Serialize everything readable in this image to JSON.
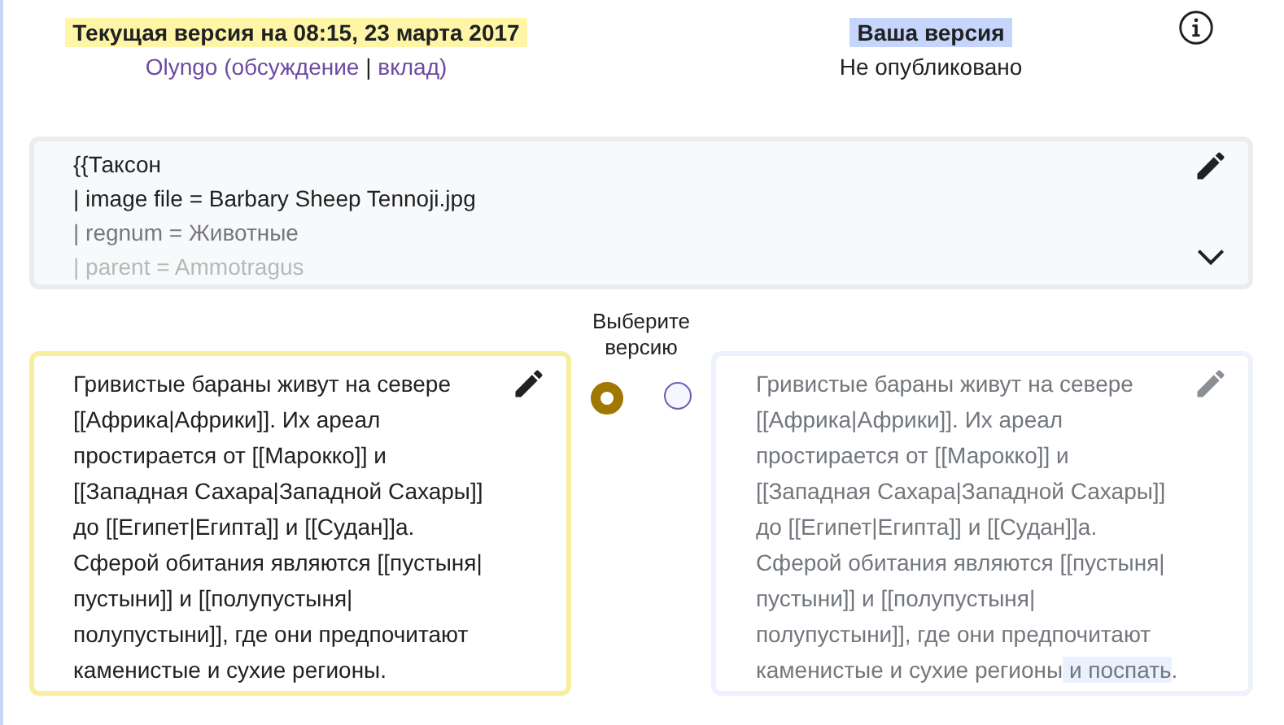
{
  "versions": [
    {
      "label": "Текущая версия на 08:15, 23 марта 2017",
      "color": "#fef6a6",
      "byline": [
        {
          "kind": "link",
          "text": "Olyngo"
        },
        {
          "kind": "punct",
          "text": " ("
        },
        {
          "kind": "link",
          "text": "обсуждение"
        },
        {
          "kind": "sep",
          "text": " | "
        },
        {
          "kind": "link",
          "text": "вклад"
        },
        {
          "kind": "punct",
          "text": ")"
        }
      ],
      "selected": true,
      "lines": [
        "Гривистые бараны живут на севере",
        "[[Африка|Африки]]. Их ареал",
        "простирается от [[Марокко]] и",
        "[[Западная Сахара|Западной Сахары]]",
        "до [[Египет|Египта]] и [[Судан]]а.",
        "Сферой обитания являются [[пустыня|",
        "пустыни]] и [[полупустыня|",
        "полупустыни]], где они предпочитают",
        "каменистые и сухие регионы."
      ]
    },
    {
      "label": "Ваша версия",
      "color": "#c5d5fb",
      "status": "Не опубликовано",
      "selected": false,
      "lines": [
        "Гривистые бараны живут на севере",
        "[[Африка|Африки]]. Их ареал",
        "простирается от [[Марокко]] и",
        "[[Западная Сахара|Западной Сахары]]",
        "до [[Египет|Египта]] и [[Судан]]а.",
        "Сферой обитания являются [[пустыня|",
        "пустыни]] и [[полупустыня|",
        "полупустыни]], где они предпочитают",
        "каменистые и сухие регионы"
      ],
      "added": " и поспать",
      "tail": "."
    }
  ],
  "template": {
    "expanded": false,
    "lines": [
      "{{Таксон",
      "| image file = Barbary Sheep Tennoji.jpg",
      "| regnum = Животные",
      "| parent = Ammotragus"
    ]
  },
  "chooser": {
    "label": "Выберите версию"
  }
}
